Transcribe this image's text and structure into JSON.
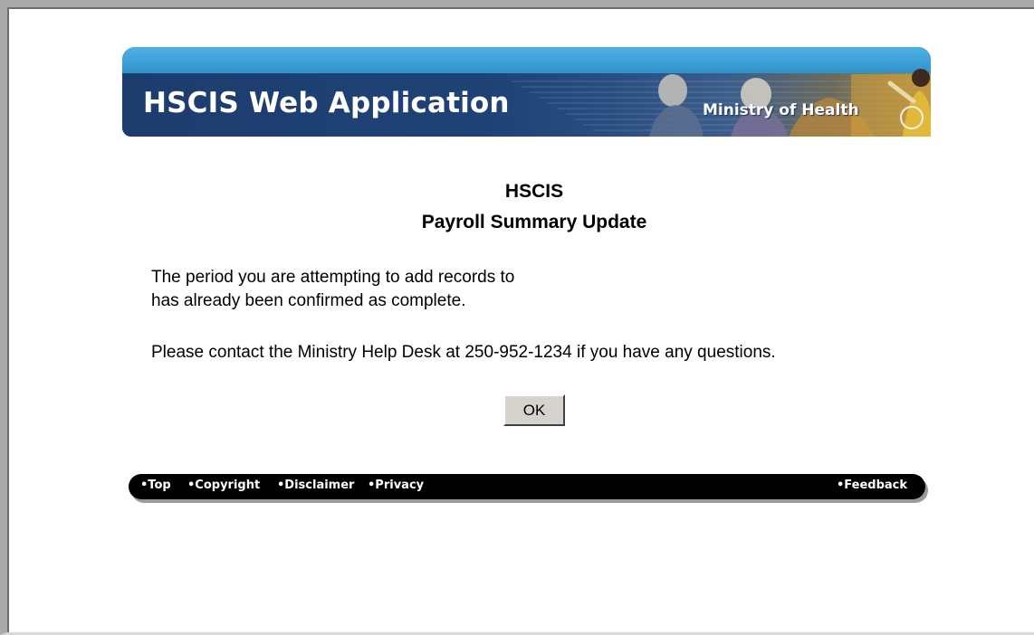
{
  "banner": {
    "title": "HSCIS Web Application",
    "ministry": "Ministry of Health"
  },
  "heading": {
    "line1": "HSCIS",
    "line2": "Payroll Summary Update"
  },
  "message": {
    "line1": "The period you are attempting to add records to",
    "line2": "has already been confirmed as complete.",
    "line3": "Please contact the Ministry Help Desk at 250-952-1234 if you have any questions."
  },
  "ok_button": {
    "label": "OK"
  },
  "footer": {
    "links": [
      {
        "label": "•Top"
      },
      {
        "label": "•Copyright"
      },
      {
        "label": "•Disclaimer"
      },
      {
        "label": "•Privacy"
      },
      {
        "label": "•Feedback"
      }
    ]
  },
  "colors": {
    "banner_top": "#2f93cc",
    "banner_body": "#1d3c6e",
    "footer_bar": "#000000",
    "button_face": "#d6d3ce"
  }
}
